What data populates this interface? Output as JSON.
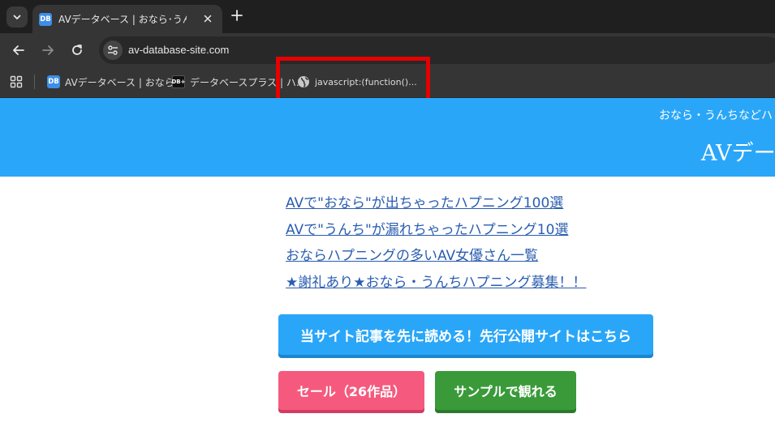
{
  "browser": {
    "tab": {
      "favicon_text": "DB",
      "title": "AVデータベース | おなら･うんちなどハ"
    },
    "address_bar": {
      "url": "av-database-site.com"
    },
    "bookmarks": [
      {
        "favicon_text": "DB",
        "label": "AVデータベース | おなら..."
      },
      {
        "favicon_text": "DB+",
        "label": "データベースプラス | ハ..."
      },
      {
        "icon": "globe-icon",
        "label": "javascript:(function()..."
      }
    ]
  },
  "site": {
    "tagline": "おなら・うんちなどハ",
    "name": "AVデー",
    "header_color": "#2aa6f8",
    "links": [
      "AVで\"おなら\"が出ちゃったハプニング100選",
      "AVで\"うんち\"が漏れちゃったハプニング10選",
      "おならハプニングの多いAV女優さん一覧",
      "★謝礼あり★おなら・うんちハプニング募集！！"
    ],
    "buttons": {
      "presale": "当サイト記事を先に読める！先行公開サイトはこちら",
      "sale": "セール（26作品）",
      "sample": "サンプルで観れる"
    }
  }
}
